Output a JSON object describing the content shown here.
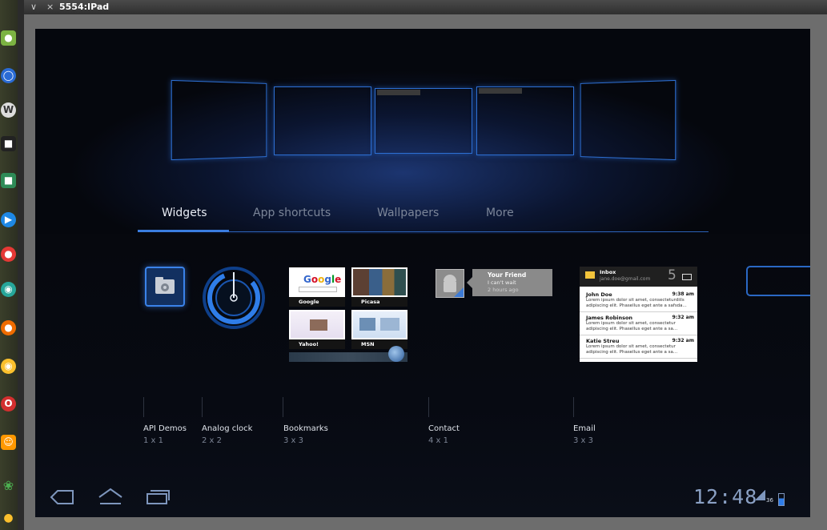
{
  "window": {
    "title": "5554:IPad"
  },
  "tabs": [
    {
      "label": "Widgets"
    },
    {
      "label": "App shortcuts"
    },
    {
      "label": "Wallpapers"
    },
    {
      "label": "More"
    }
  ],
  "bookmarks": {
    "google": "Google",
    "picasa": "Picasa",
    "yahoo": "Yahoo!",
    "msn": "MSN"
  },
  "contact_widget": {
    "name": "Your Friend",
    "status": "I can't wait",
    "time": "2 hours ago"
  },
  "email_widget": {
    "folder": "Inbox",
    "account": "jane.doe@gmail.com",
    "count": "5",
    "messages": [
      {
        "sender": "John Doe",
        "time": "9:38 am",
        "preview": "Lorem ipsum dolor sit amet, consecteturdiils adipiscing elit. Phasellus eget ante a safsda..."
      },
      {
        "sender": "James Robinson",
        "time": "9:32 am",
        "preview": "Lorem ipsum dolor sit amet, consectetur adipiscing elit. Phasellus eget ante a sa..."
      },
      {
        "sender": "Katie Streu",
        "time": "9:32 am",
        "preview": "Lorem ipsum dolor sit amet, consectetur adipiscing elit. Phasellus eget ante a sa..."
      }
    ]
  },
  "widgets": [
    {
      "name": "API Demos",
      "size": "1 x 1"
    },
    {
      "name": "Analog clock",
      "size": "2 x 2"
    },
    {
      "name": "Bookmarks",
      "size": "3 x 3"
    },
    {
      "name": "Contact",
      "size": "4 x 1"
    },
    {
      "name": "Email",
      "size": "3 x 3"
    }
  ],
  "status_bar": {
    "time": "12:48",
    "battery": "36"
  },
  "colors": {
    "accent": "#3a7de0",
    "screen_bg": "#05070d"
  }
}
